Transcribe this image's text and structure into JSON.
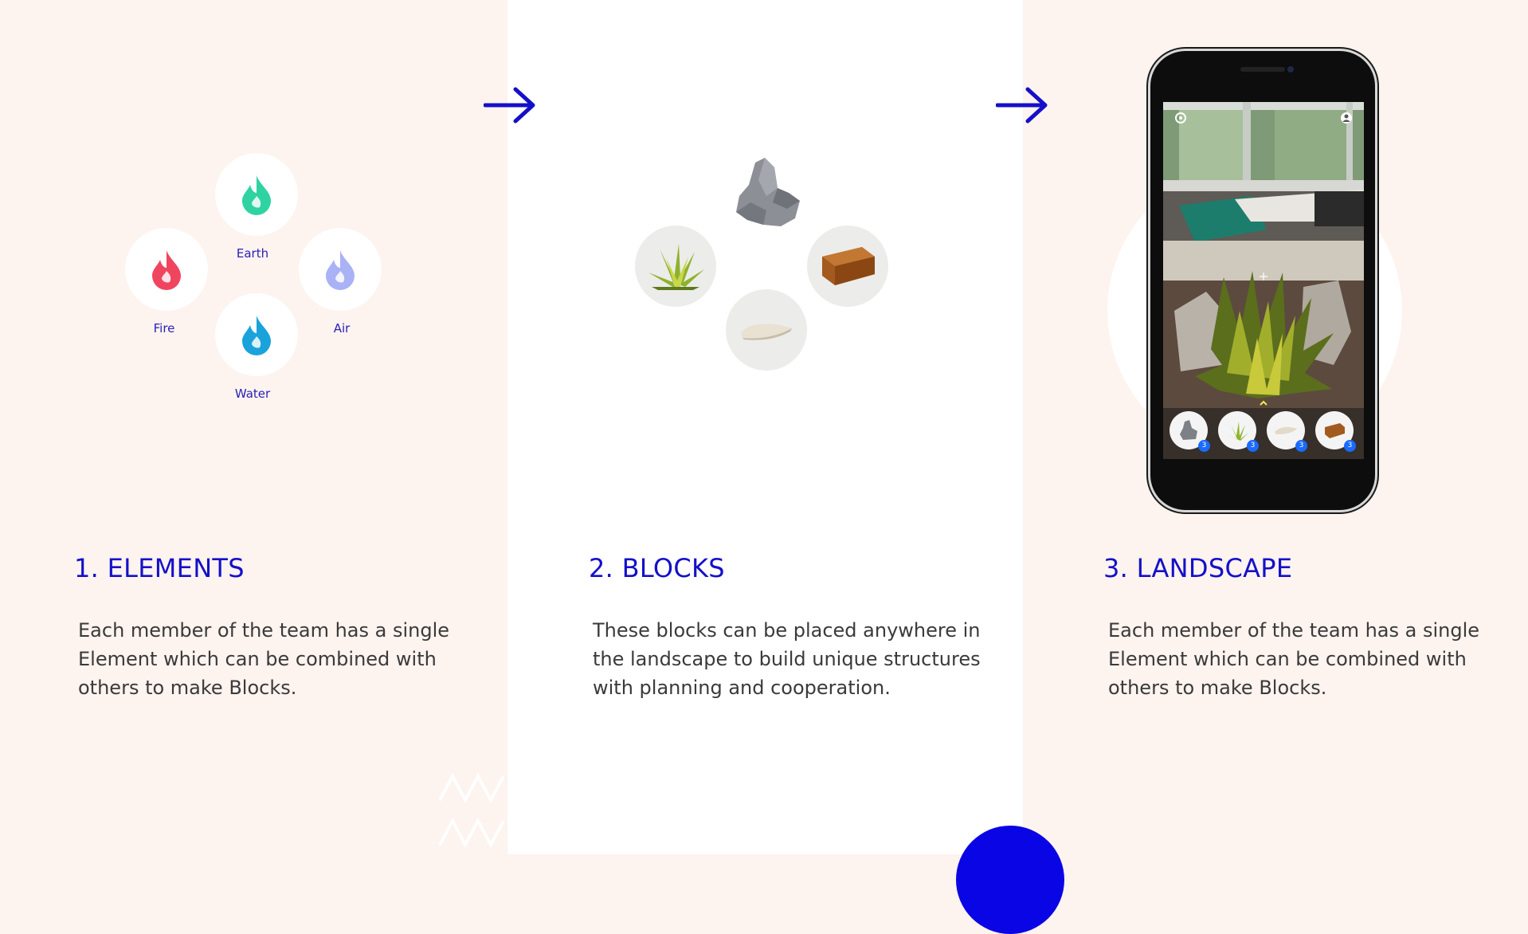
{
  "colors": {
    "accent": "#1410c9",
    "panel_tint": "#fdf3ef",
    "body_text": "#3a3a3a",
    "fire": "#f0455f",
    "earth": "#2fd3a2",
    "air": "#a9b2f5",
    "water": "#1aa3db"
  },
  "sections": [
    {
      "heading": "1. ELEMENTS",
      "body": "Each member of the team has a single Element which can be combined with others to make Blocks."
    },
    {
      "heading": "2. BLOCKS",
      "body": "These blocks can be placed anywhere in the landscape to build unique structures with planning and cooperation."
    },
    {
      "heading": "3. LANDSCAPE",
      "body": "Each member of the team has a single Element which can be combined with others to make Blocks."
    }
  ],
  "elements": [
    {
      "label": "Earth",
      "icon": "drop-icon"
    },
    {
      "label": "Fire",
      "icon": "flame-icon"
    },
    {
      "label": "Air",
      "icon": "drop-icon"
    },
    {
      "label": "Water",
      "icon": "drop-icon"
    }
  ],
  "blocks": [
    "rock",
    "grass",
    "brick",
    "bone"
  ],
  "phone_tray": {
    "items": [
      {
        "name": "rock",
        "count": "3"
      },
      {
        "name": "grass",
        "count": "3"
      },
      {
        "name": "bone",
        "count": "3"
      },
      {
        "name": "brick",
        "count": "3"
      }
    ]
  }
}
